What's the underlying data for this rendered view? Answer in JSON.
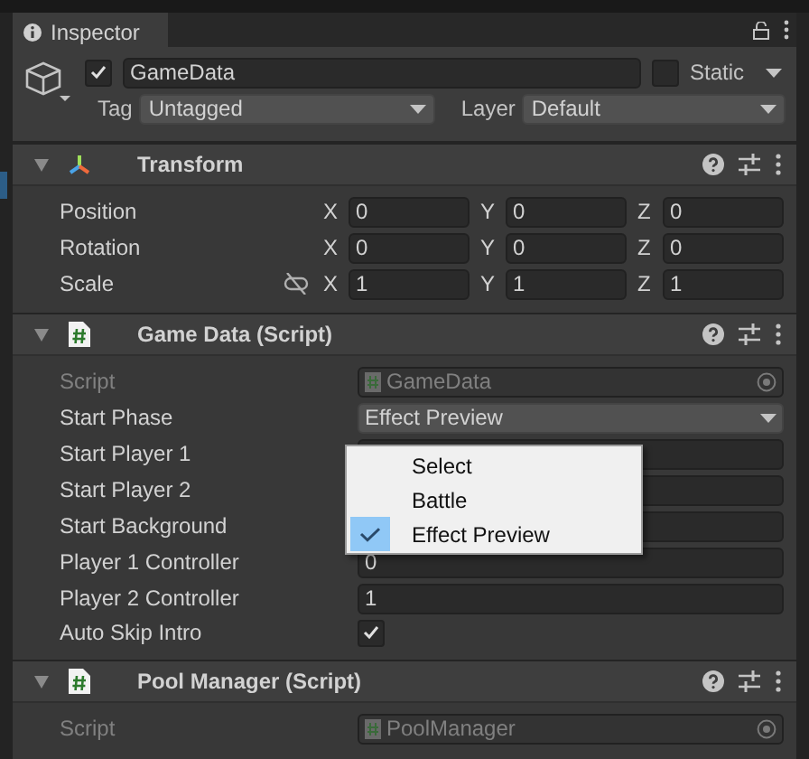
{
  "tab": {
    "label": "Inspector",
    "selected": true
  },
  "object": {
    "active": true,
    "name": "GameData",
    "static": false,
    "static_label": "Static",
    "tag_label": "Tag",
    "tag": "Untagged",
    "layer_label": "Layer",
    "layer": "Default"
  },
  "components": [
    {
      "title": "Transform",
      "kind": "transform",
      "expanded": true,
      "rows": [
        {
          "kind": "vector",
          "label": "Position",
          "values": [
            {
              "axis": "X",
              "value": "0"
            },
            {
              "axis": "Y",
              "value": "0"
            },
            {
              "axis": "Z",
              "value": "0"
            }
          ]
        },
        {
          "kind": "vector",
          "label": "Rotation",
          "values": [
            {
              "axis": "X",
              "value": "0"
            },
            {
              "axis": "Y",
              "value": "0"
            },
            {
              "axis": "Z",
              "value": "0"
            }
          ]
        },
        {
          "kind": "vector",
          "label": "Scale",
          "constrain_proportions": false,
          "values": [
            {
              "axis": "X",
              "value": "1"
            },
            {
              "axis": "Y",
              "value": "1"
            },
            {
              "axis": "Z",
              "value": "1"
            }
          ]
        }
      ]
    },
    {
      "title": "Game Data (Script)",
      "kind": "script",
      "expanded": true,
      "rows": [
        {
          "kind": "script",
          "label": "Script",
          "value": "GameData"
        },
        {
          "kind": "dropdown",
          "label": "Start Phase",
          "value": "Effect Preview",
          "open": true
        },
        {
          "kind": "field",
          "label": "Start Player 1"
        },
        {
          "kind": "field",
          "label": "Start Player 2"
        },
        {
          "kind": "field",
          "label": "Start Background"
        },
        {
          "kind": "field",
          "label": "Player 1 Controller",
          "value": "0"
        },
        {
          "kind": "field",
          "label": "Player 2 Controller",
          "value": "1"
        },
        {
          "kind": "checkbox",
          "label": "Auto Skip Intro",
          "checked": true
        }
      ]
    },
    {
      "title": "Pool Manager (Script)",
      "kind": "script",
      "expanded": true,
      "rows": [
        {
          "kind": "script",
          "label": "Script",
          "value": "PoolManager"
        }
      ]
    }
  ],
  "dropdown_menu": {
    "items": [
      {
        "label": "Select",
        "selected": false
      },
      {
        "label": "Battle",
        "selected": false
      },
      {
        "label": "Effect Preview",
        "selected": true
      }
    ]
  }
}
